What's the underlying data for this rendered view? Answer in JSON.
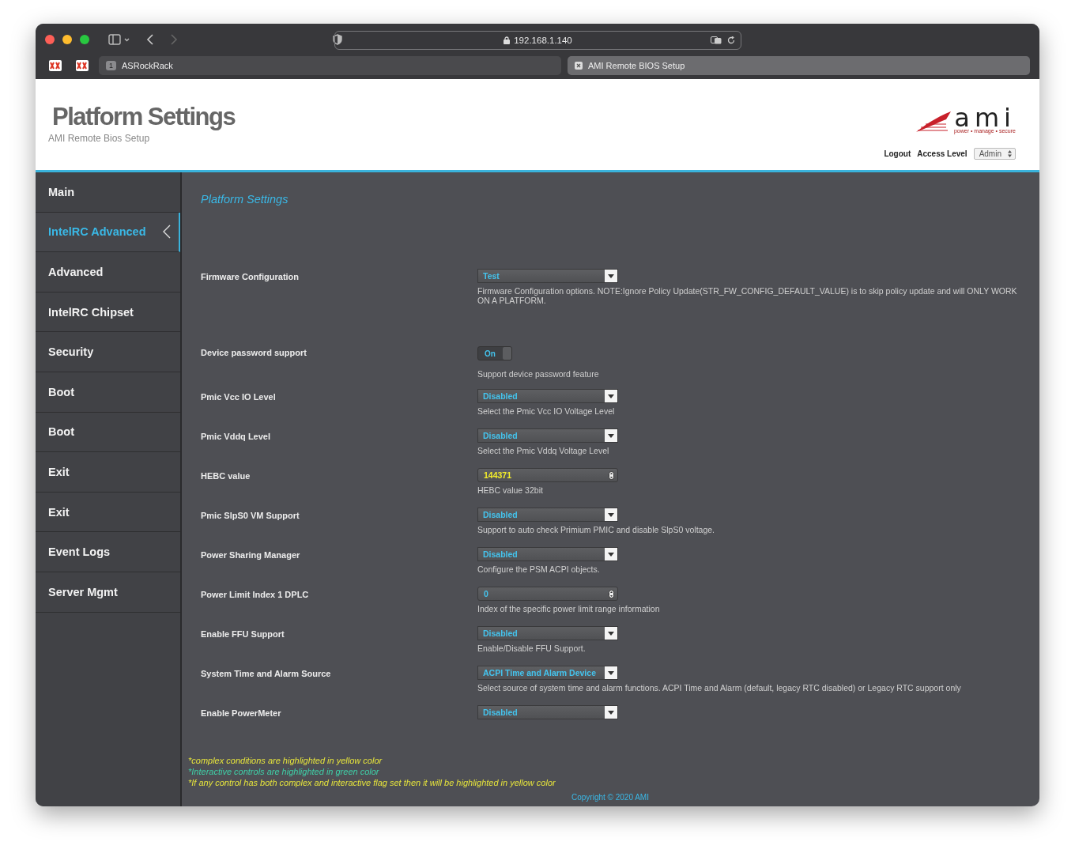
{
  "browser": {
    "address": "192.168.1.140",
    "tabs": [
      {
        "label": "ASRockRack",
        "badge": "1",
        "selected": false
      },
      {
        "label": "AMI Remote BIOS Setup",
        "selected": true
      }
    ]
  },
  "header": {
    "title": "Platform Settings",
    "subtitle": "AMI Remote Bios Setup",
    "logo": {
      "name": "ami",
      "tagline": "power • manage • secure"
    },
    "logout": "Logout",
    "access_label": "Access Level",
    "access_value": "Admin"
  },
  "sidebar": {
    "items": [
      {
        "label": "Main",
        "selected": false
      },
      {
        "label": "IntelRC Advanced",
        "selected": true
      },
      {
        "label": "Advanced",
        "selected": false
      },
      {
        "label": "IntelRC Chipset",
        "selected": false
      },
      {
        "label": "Security",
        "selected": false
      },
      {
        "label": "Boot",
        "selected": false
      },
      {
        "label": "Boot",
        "selected": false
      },
      {
        "label": "Exit",
        "selected": false
      },
      {
        "label": "Exit",
        "selected": false
      },
      {
        "label": "Event Logs",
        "selected": false
      },
      {
        "label": "Server Mgmt",
        "selected": false
      }
    ]
  },
  "content": {
    "title": "Platform Settings",
    "settings": [
      {
        "kind": "select",
        "label": "Firmware Configuration",
        "value": "Test",
        "complex": false,
        "description": "Firmware Configuration options. NOTE:Ignore Policy Update(STR_FW_CONFIG_DEFAULT_VALUE) is to skip policy update and will ONLY WORK ON A PLATFORM."
      },
      {
        "kind": "toggle",
        "label": "Device password support",
        "value": "On",
        "on": true,
        "complex": false,
        "description": "Support device password feature"
      },
      {
        "kind": "select",
        "label": "Pmic Vcc IO Level",
        "value": "Disabled",
        "complex": false,
        "description": "Select the Pmic Vcc IO Voltage Level"
      },
      {
        "kind": "select",
        "label": "Pmic Vddq Level",
        "value": "Disabled",
        "complex": false,
        "description": "Select the Pmic Vddq Voltage Level"
      },
      {
        "kind": "number",
        "label": "HEBC value",
        "value": "144371",
        "complex": true,
        "description": "HEBC value 32bit"
      },
      {
        "kind": "select",
        "label": "Pmic SlpS0 VM Support",
        "value": "Disabled",
        "complex": false,
        "description": "Support to auto check Primium PMIC and disable SlpS0 voltage."
      },
      {
        "kind": "select",
        "label": "Power Sharing Manager",
        "value": "Disabled",
        "complex": false,
        "description": "Configure the PSM ACPI objects."
      },
      {
        "kind": "number",
        "label": "Power Limit Index 1 DPLC",
        "value": "0",
        "complex": false,
        "description": "Index of the specific power limit range information"
      },
      {
        "kind": "select",
        "label": "Enable FFU Support",
        "value": "Disabled",
        "complex": false,
        "description": "Enable/Disable FFU Support."
      },
      {
        "kind": "select",
        "label": "System Time and Alarm Source",
        "value": "ACPI Time and Alarm Device",
        "complex": false,
        "description": "Select source of system time and alarm functions. ACPI Time and Alarm (default, legacy RTC disabled) or Legacy RTC support only"
      },
      {
        "kind": "select",
        "label": "Enable PowerMeter",
        "value": "Disabled",
        "complex": false
      }
    ],
    "notes": [
      {
        "text": "*complex conditions are highlighted in yellow color",
        "color": "#e6e43c"
      },
      {
        "text": "*Interactive controls are highlighted in green color",
        "color": "#3fd0a8"
      },
      {
        "text": "*If any control has both complex and interactive flag set then it will be highlighted in yellow color",
        "color": "#e6e43c"
      }
    ],
    "copyright": "Copyright © 2020 AMI"
  }
}
